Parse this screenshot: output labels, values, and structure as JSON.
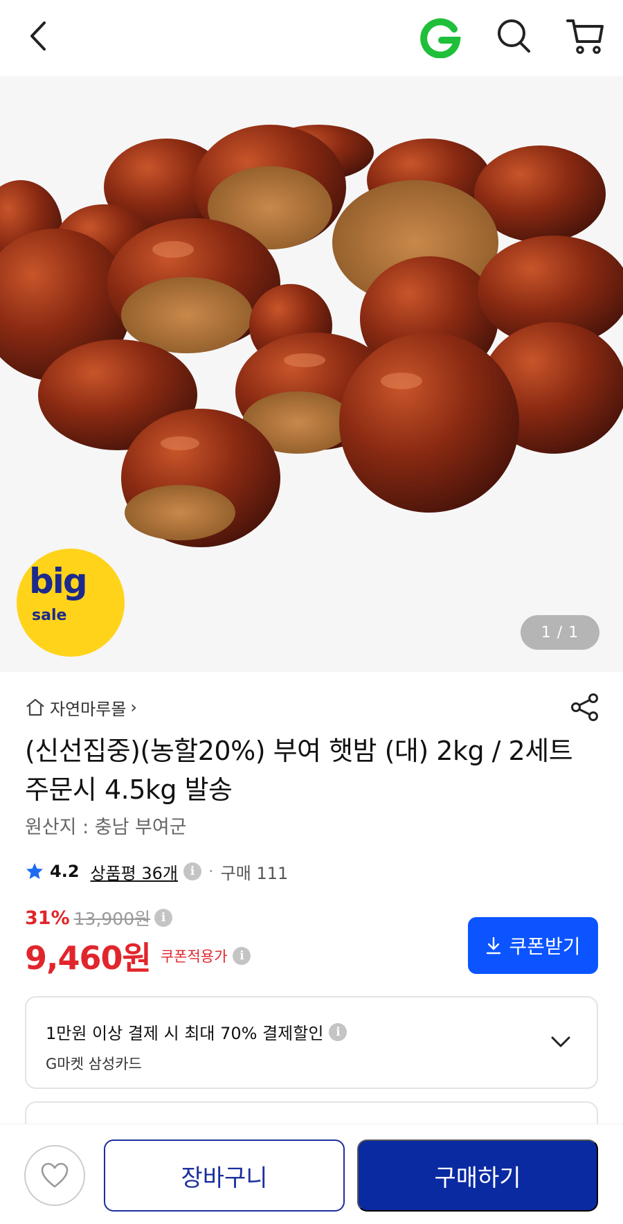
{
  "header": {
    "back_icon": "chevron-left-icon",
    "logo_letter": "G",
    "search_icon": "search-icon",
    "cart_icon": "cart-icon"
  },
  "hero": {
    "image_counter": "1 / 1",
    "badge": {
      "big": "big",
      "sale": "sale"
    }
  },
  "store": {
    "name": "자연마루몰",
    "chevron": "›"
  },
  "product": {
    "title": "(신선집중)(농할20%) 부여 햇밤 (대) 2kg / 2세트 주문시 4.5kg 발송",
    "origin": "원산지 : 충남 부여군"
  },
  "rating": {
    "score": "4.2",
    "reviews": "상품평 36개",
    "separator": "·",
    "purchases": "구매 111"
  },
  "price": {
    "discount_pct": "31%",
    "original": "13,900원",
    "final": "9,460원",
    "coupon_note": "쿠폰적용가",
    "coupon_button": "쿠폰받기"
  },
  "benefit": {
    "line1": "1만원 이상 결제 시 최대 70% 결제할인",
    "line2": "G마켓 삼성카드"
  },
  "bottom": {
    "cart_label": "장바구니",
    "buy_label": "구매하기"
  },
  "colors": {
    "accent_blue": "#0b54ff",
    "buy_blue": "#0a2aa2",
    "price_red": "#e0262c",
    "logo_green": "#1fbf3a"
  }
}
